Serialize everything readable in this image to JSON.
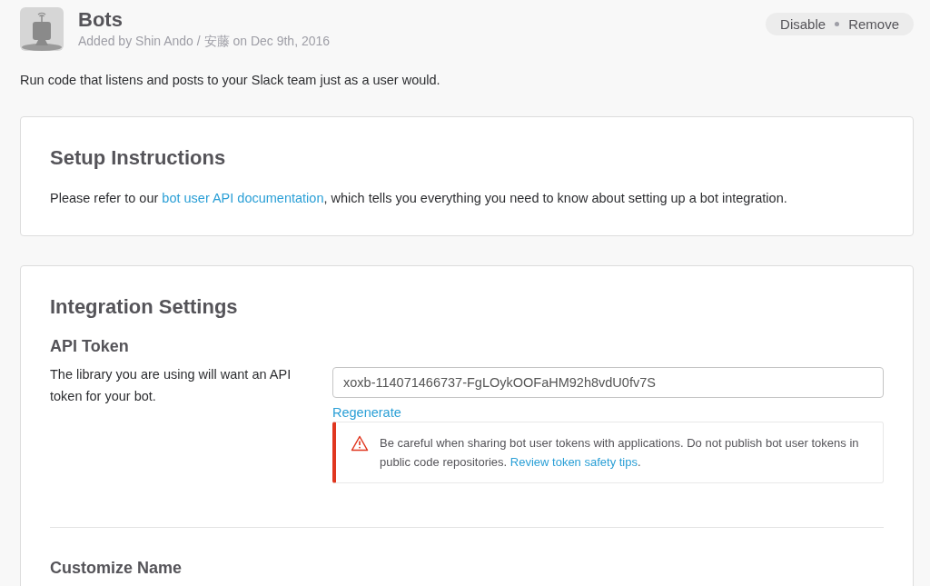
{
  "header": {
    "title": "Bots",
    "subtitle": "Added by Shin Ando / 安藤 on Dec 9th, 2016",
    "actions": [
      "Disable",
      "Remove"
    ]
  },
  "description": "Run code that listens and posts to your Slack team just as a user would.",
  "setup": {
    "title": "Setup Instructions",
    "text_before": "Please refer to our ",
    "link": "bot user API documentation",
    "text_after": ", which tells you everything you need to know about setting up a bot integration."
  },
  "settings": {
    "title": "Integration Settings",
    "api_token": {
      "heading": "API Token",
      "help": "The library you are using will want an API token for your bot.",
      "value": "xoxb-114071466737-FgLOykOOFaHM92h8vdU0fv7S",
      "regenerate": "Regenerate",
      "warning": {
        "text": "Be careful when sharing bot user tokens with applications. Do not publish bot user tokens in public code repositories. ",
        "link": "Review token safety tips",
        "after": "."
      }
    },
    "next_heading": "Customize Name"
  }
}
